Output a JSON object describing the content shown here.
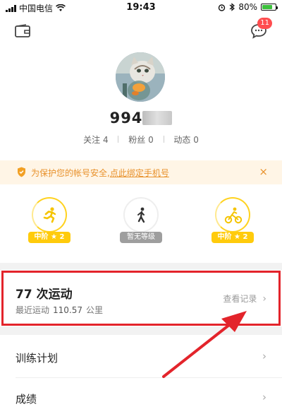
{
  "status_bar": {
    "carrier": "中国电信",
    "time": "19:43",
    "battery": "80%",
    "battery_level": 0.8
  },
  "header": {
    "message_badge": "11"
  },
  "profile": {
    "username": "994",
    "stats": [
      {
        "label": "关注",
        "count": "4"
      },
      {
        "label": "粉丝",
        "count": "0"
      },
      {
        "label": "动态",
        "count": "0"
      }
    ]
  },
  "notice": {
    "text": "为保护您的帐号安全,",
    "link": "点此绑定手机号",
    "close": "×"
  },
  "levels": [
    {
      "icon": "running-icon",
      "tag": "中阶 ★ 2",
      "active": true
    },
    {
      "icon": "walking-icon",
      "tag": "暂无等级",
      "active": false
    },
    {
      "icon": "cycling-icon",
      "tag": "中阶 ★ 2",
      "active": true
    }
  ],
  "activity": {
    "title": "77 次运动",
    "recent_label": "最近运动",
    "recent_value": "110.57",
    "recent_unit": "公里",
    "more": "查看记录"
  },
  "menu": [
    {
      "label": "训练计划"
    },
    {
      "label": "成绩"
    }
  ],
  "colors": {
    "accent": "#ffcb0c",
    "notice": "#e8912b",
    "highlight": "#e3242b",
    "badge": "#ff4d4f"
  }
}
